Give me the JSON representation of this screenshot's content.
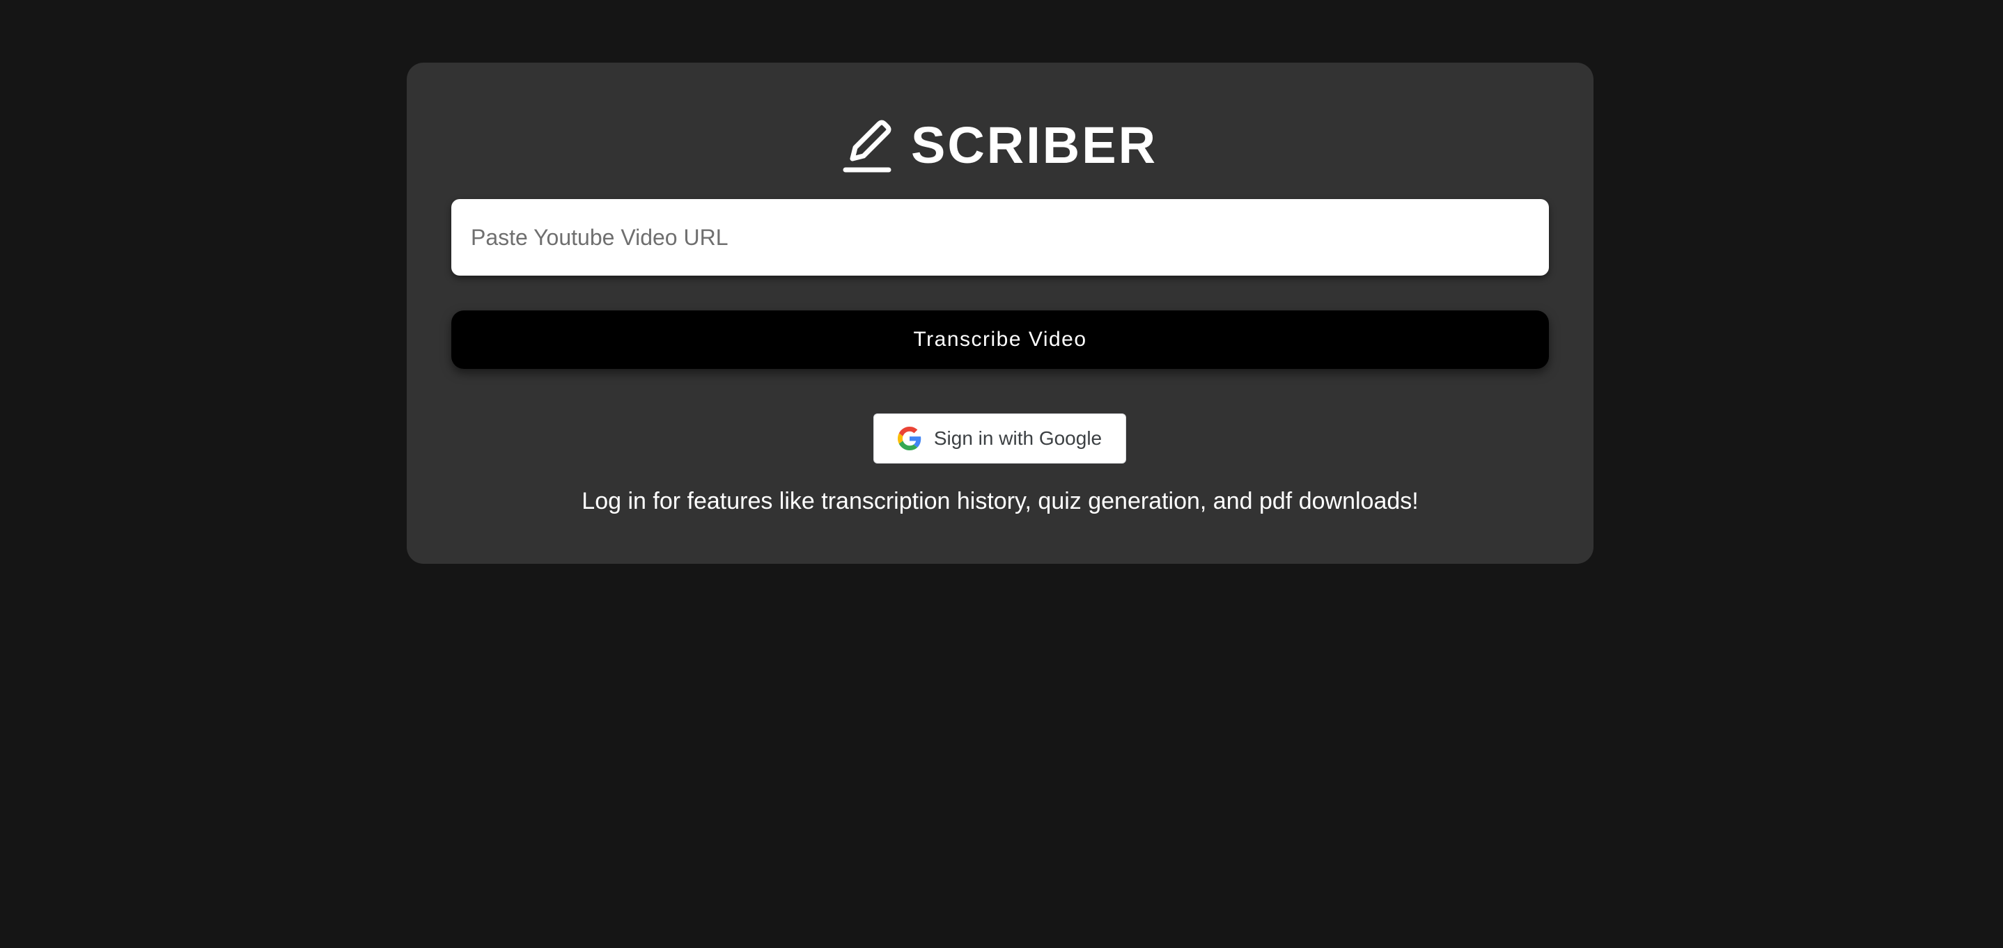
{
  "brand": {
    "title": "SCRIBER",
    "icon": "pencil-icon"
  },
  "url_input": {
    "placeholder": "Paste Youtube Video URL",
    "value": ""
  },
  "transcribe_button": {
    "label": "Transcribe Video"
  },
  "google_signin": {
    "label": "Sign in with Google",
    "icon": "google-icon"
  },
  "note": {
    "text": "Log in for features like transcription history, quiz generation, and pdf downloads!"
  },
  "colors": {
    "background": "#151515",
    "card": "#333333",
    "button": "#000000",
    "text": "#ffffff"
  }
}
